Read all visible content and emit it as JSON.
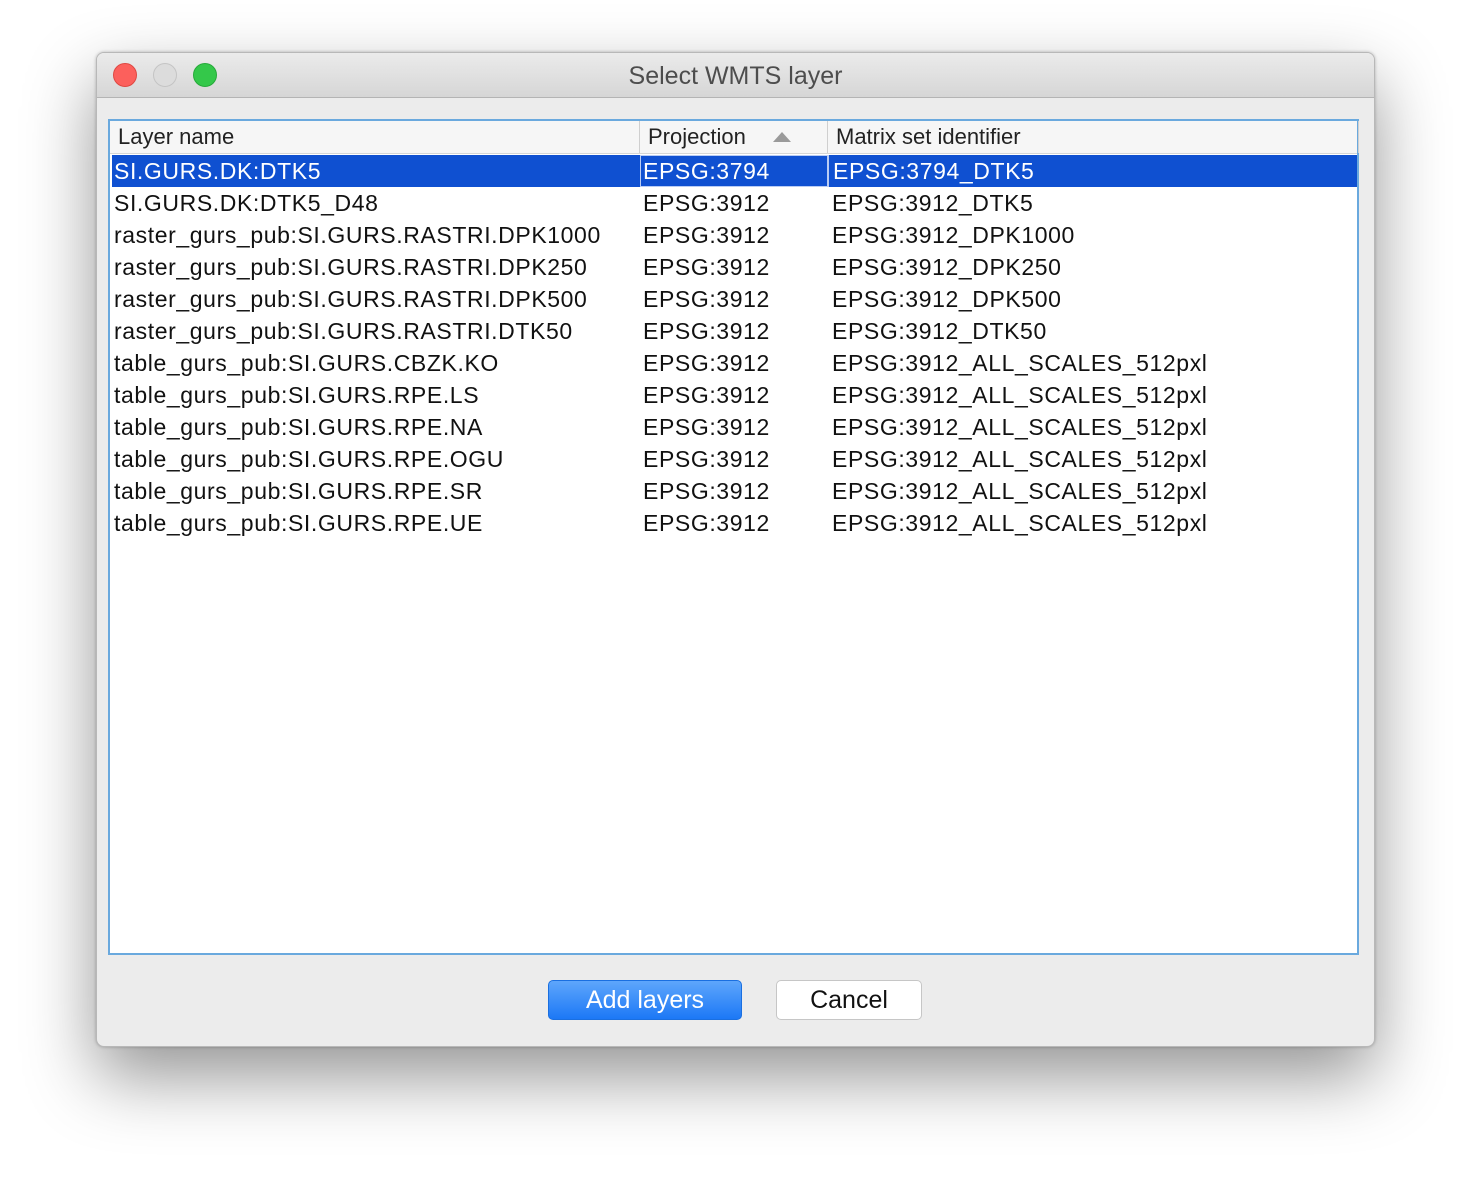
{
  "window": {
    "title": "Select WMTS layer"
  },
  "table": {
    "columns": [
      "Layer name",
      "Projection",
      "Matrix set identifier"
    ],
    "sorted_column": "Projection",
    "sort_direction": "ascending",
    "selected_row_index": 0,
    "rows": [
      [
        "SI.GURS.DK:DTK5",
        "EPSG:3794",
        "EPSG:3794_DTK5"
      ],
      [
        "SI.GURS.DK:DTK5_D48",
        "EPSG:3912",
        "EPSG:3912_DTK5"
      ],
      [
        "raster_gurs_pub:SI.GURS.RASTRI.DPK1000",
        "EPSG:3912",
        "EPSG:3912_DPK1000"
      ],
      [
        "raster_gurs_pub:SI.GURS.RASTRI.DPK250",
        "EPSG:3912",
        "EPSG:3912_DPK250"
      ],
      [
        "raster_gurs_pub:SI.GURS.RASTRI.DPK500",
        "EPSG:3912",
        "EPSG:3912_DPK500"
      ],
      [
        "raster_gurs_pub:SI.GURS.RASTRI.DTK50",
        "EPSG:3912",
        "EPSG:3912_DTK50"
      ],
      [
        "table_gurs_pub:SI.GURS.CBZK.KO",
        "EPSG:3912",
        "EPSG:3912_ALL_SCALES_512pxl"
      ],
      [
        "table_gurs_pub:SI.GURS.RPE.LS",
        "EPSG:3912",
        "EPSG:3912_ALL_SCALES_512pxl"
      ],
      [
        "table_gurs_pub:SI.GURS.RPE.NA",
        "EPSG:3912",
        "EPSG:3912_ALL_SCALES_512pxl"
      ],
      [
        "table_gurs_pub:SI.GURS.RPE.OGU",
        "EPSG:3912",
        "EPSG:3912_ALL_SCALES_512pxl"
      ],
      [
        "table_gurs_pub:SI.GURS.RPE.SR",
        "EPSG:3912",
        "EPSG:3912_ALL_SCALES_512pxl"
      ],
      [
        "table_gurs_pub:SI.GURS.RPE.UE",
        "EPSG:3912",
        "EPSG:3912_ALL_SCALES_512pxl"
      ]
    ]
  },
  "buttons": {
    "add_layers": "Add layers",
    "cancel": "Cancel"
  },
  "icons": {
    "close": "close-traffic-light-icon",
    "minimize": "minimize-traffic-light-icon",
    "zoom": "zoom-traffic-light-icon",
    "sort": "sort-ascending-icon"
  },
  "colors": {
    "selection": "#0f50d1",
    "primary_button": "#1c78f6",
    "focus_border": "#6aa9de"
  }
}
